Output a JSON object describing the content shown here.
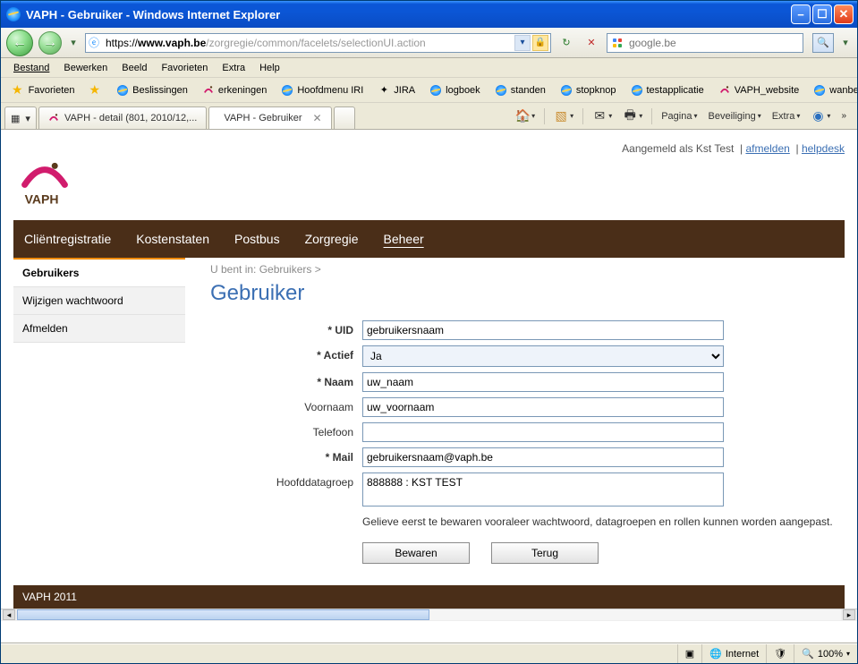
{
  "window": {
    "title": "VAPH - Gebruiker - Windows Internet Explorer"
  },
  "address": {
    "proto": "https://",
    "host": "www.vaph.be",
    "path": "/zorgregie/common/facelets/selectionUI.action"
  },
  "search": {
    "placeholder": "google.be"
  },
  "menus": [
    "Bestand",
    "Bewerken",
    "Beeld",
    "Favorieten",
    "Extra",
    "Help"
  ],
  "fav_label": "Favorieten",
  "links": [
    "Beslissingen",
    "erkeningen",
    "Hoofdmenu IRI",
    "JIRA",
    "logboek",
    "standen",
    "stopknop",
    "testapplicatie",
    "VAPH_website",
    "wanbetalers"
  ],
  "tabs": {
    "t1": "VAPH - detail (801, 2010/12,...",
    "t2": "VAPH - Gebruiker"
  },
  "cmdbar": {
    "page": "Pagina",
    "security": "Beveiliging",
    "extra": "Extra"
  },
  "top_user": {
    "logged_in_as_prefix": "Aangemeld als ",
    "username": "Kst Test",
    "logout": "afmelden",
    "helpdesk": "helpdesk"
  },
  "main_nav": [
    "Cliëntregistratie",
    "Kostenstaten",
    "Postbus",
    "Zorgregie",
    "Beheer"
  ],
  "main_nav_selected": 4,
  "side_nav": [
    "Gebruikers",
    "Wijzigen wachtwoord",
    "Afmelden"
  ],
  "side_nav_selected": 0,
  "breadcrumb_prefix": "U bent in: ",
  "breadcrumb_item": "Gebruikers",
  "page_title": "Gebruiker",
  "form": {
    "labels": {
      "uid": "* UID",
      "actief": "* Actief",
      "naam": "* Naam",
      "voornaam": "Voornaam",
      "telefoon": "Telefoon",
      "mail": "* Mail",
      "hoofddatagroep": "Hoofddatagroep"
    },
    "values": {
      "uid": "gebruikersnaam",
      "actief_selected": "Ja",
      "naam": "uw_naam",
      "voornaam": "uw_voornaam",
      "telefoon": "",
      "mail": "gebruikersnaam@vaph.be",
      "hoofddatagroep": "888888 : KST TEST"
    }
  },
  "note": "Gelieve eerst te bewaren vooraleer wachtwoord, datagroepen en rollen kunnen worden aangepast.",
  "buttons": {
    "save": "Bewaren",
    "back": "Terug"
  },
  "footer": "VAPH 2011",
  "status": {
    "zone": "Internet",
    "zoom": "100%"
  }
}
